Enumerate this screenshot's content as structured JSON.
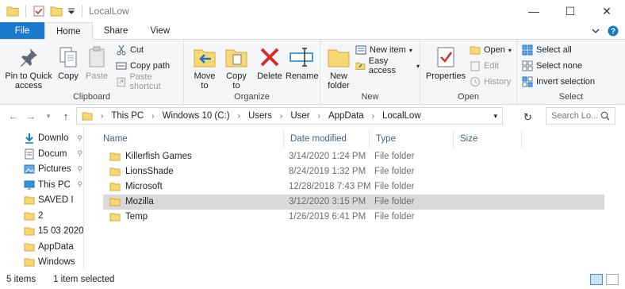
{
  "window": {
    "title": "LocalLow",
    "controls": {
      "minimize": "—",
      "maximize": "☐",
      "close": "✕"
    }
  },
  "ribbon_tabs": [
    "File",
    "Home",
    "Share",
    "View"
  ],
  "ribbon": {
    "clipboard": {
      "label": "Clipboard",
      "pin": "Pin to Quick access",
      "copy": "Copy",
      "paste": "Paste",
      "cut": "Cut",
      "copy_path": "Copy path",
      "paste_shortcut": "Paste shortcut"
    },
    "organize": {
      "label": "Organize",
      "move_to": "Move to",
      "copy_to": "Copy to",
      "delete": "Delete",
      "rename": "Rename"
    },
    "new": {
      "label": "New",
      "new_folder": "New folder",
      "new_item": "New item",
      "easy_access": "Easy access"
    },
    "open": {
      "label": "Open",
      "properties": "Properties",
      "open": "Open",
      "edit": "Edit",
      "history": "History"
    },
    "select": {
      "label": "Select",
      "select_all": "Select all",
      "select_none": "Select none",
      "invert": "Invert selection"
    }
  },
  "address": {
    "crumbs": [
      "This PC",
      "Windows 10 (C:)",
      "Users",
      "User",
      "AppData",
      "LocalLow"
    ],
    "search_placeholder": "Search Lo..."
  },
  "nav_pane": [
    {
      "label": "Downlo",
      "icon": "download-arrow-icon",
      "pinned": true
    },
    {
      "label": "Docum",
      "icon": "documents-icon",
      "pinned": true
    },
    {
      "label": "Pictures",
      "icon": "pictures-icon",
      "pinned": true
    },
    {
      "label": "This PC",
      "icon": "monitor-icon",
      "pinned": true
    },
    {
      "label": "SAVED I",
      "icon": "folder-icon",
      "pinned": false
    },
    {
      "label": "2",
      "icon": "folder-icon",
      "pinned": false
    },
    {
      "label": "15 03 2020",
      "icon": "folder-icon",
      "pinned": false
    },
    {
      "label": "AppData",
      "icon": "folder-icon",
      "pinned": false
    },
    {
      "label": "Windows",
      "icon": "folder-icon",
      "pinned": false
    }
  ],
  "columns": [
    "Name",
    "Date modified",
    "Type",
    "Size"
  ],
  "files": [
    {
      "name": "Killerfish Games",
      "date": "3/14/2020 1:24 PM",
      "type": "File folder",
      "selected": false
    },
    {
      "name": "LionsShade",
      "date": "8/24/2019 1:32 PM",
      "type": "File folder",
      "selected": false
    },
    {
      "name": "Microsoft",
      "date": "12/28/2018 7:43 PM",
      "type": "File folder",
      "selected": false
    },
    {
      "name": "Mozilla",
      "date": "3/12/2020 3:15 PM",
      "type": "File folder",
      "selected": true
    },
    {
      "name": "Temp",
      "date": "1/26/2019 6:41 PM",
      "type": "File folder",
      "selected": false
    }
  ],
  "status": {
    "items": "5 items",
    "selected": "1 item selected"
  },
  "colors": {
    "file_tab": "#1979ca",
    "folder_yellow": "#f8d775",
    "selected_row": "#d9d9d9",
    "delete_red": "#d0312d"
  }
}
